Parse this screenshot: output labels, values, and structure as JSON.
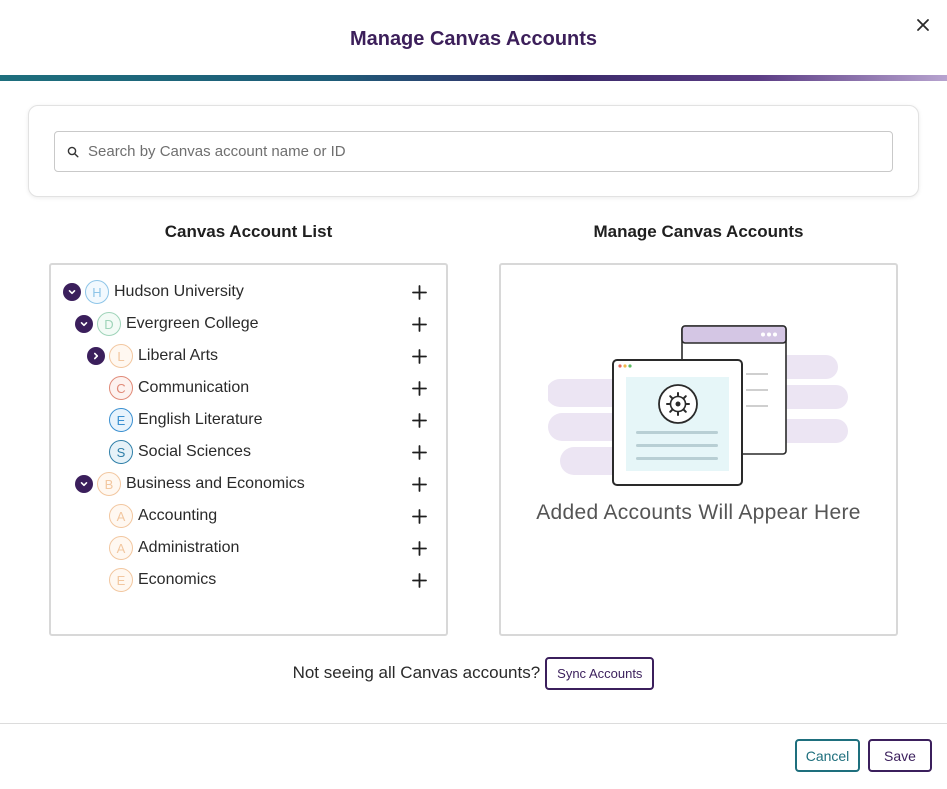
{
  "modal": {
    "title": "Manage Canvas Accounts"
  },
  "search": {
    "placeholder": "Search by Canvas account name or ID",
    "value": ""
  },
  "columns": {
    "left_title": "Canvas Account List",
    "right_title": "Manage Canvas Accounts"
  },
  "tree": [
    {
      "label": "Hudson University",
      "initial": "H",
      "level": 0,
      "expander": "expanded",
      "color": "#8ec5e8",
      "fill": "#f2f9fe"
    },
    {
      "label": "Evergreen College",
      "initial": "D",
      "level": 1,
      "expander": "expanded",
      "color": "#9fd4b9",
      "fill": "#f3fbf6"
    },
    {
      "label": "Liberal Arts",
      "initial": "L",
      "level": 2,
      "expander": "collapsed",
      "color": "#f2c7a0",
      "fill": "#fff8f1"
    },
    {
      "label": "Communication",
      "initial": "C",
      "level": 2,
      "expander": "none",
      "color": "#e08a78",
      "fill": "#fdf2ef"
    },
    {
      "label": "English Literature",
      "initial": "E",
      "level": 2,
      "expander": "none",
      "color": "#3a8fd0",
      "fill": "#e8f3fc"
    },
    {
      "label": "Social Sciences",
      "initial": "S",
      "level": 2,
      "expander": "none",
      "color": "#2f7fa8",
      "fill": "#e6f2f8"
    },
    {
      "label": "Business and Economics",
      "initial": "B",
      "level": 1,
      "expander": "expanded",
      "color": "#f2c7a0",
      "fill": "#fff8f1"
    },
    {
      "label": "Accounting",
      "initial": "A",
      "level": 2,
      "expander": "none",
      "color": "#f2c7a0",
      "fill": "#fff8f1"
    },
    {
      "label": "Administration",
      "initial": "A",
      "level": 2,
      "expander": "none",
      "color": "#f2c7a0",
      "fill": "#fff8f1"
    },
    {
      "label": "Economics",
      "initial": "E",
      "level": 2,
      "expander": "none",
      "color": "#f2c7a0",
      "fill": "#fff8f1"
    }
  ],
  "empty_state": {
    "message": "Added Accounts Will Appear Here"
  },
  "sync": {
    "prompt": "Not seeing all Canvas accounts?",
    "button_label": "Sync Accounts"
  },
  "footer": {
    "cancel_label": "Cancel",
    "save_label": "Save"
  },
  "icons": {
    "close": "close-icon",
    "search": "search-icon",
    "expand": "chevron-down-icon",
    "collapse": "chevron-right-icon",
    "add": "plus-icon",
    "empty": "gear-illustration"
  },
  "colors": {
    "brand_purple": "#3b1f5c",
    "brand_teal": "#1e6f7d"
  }
}
